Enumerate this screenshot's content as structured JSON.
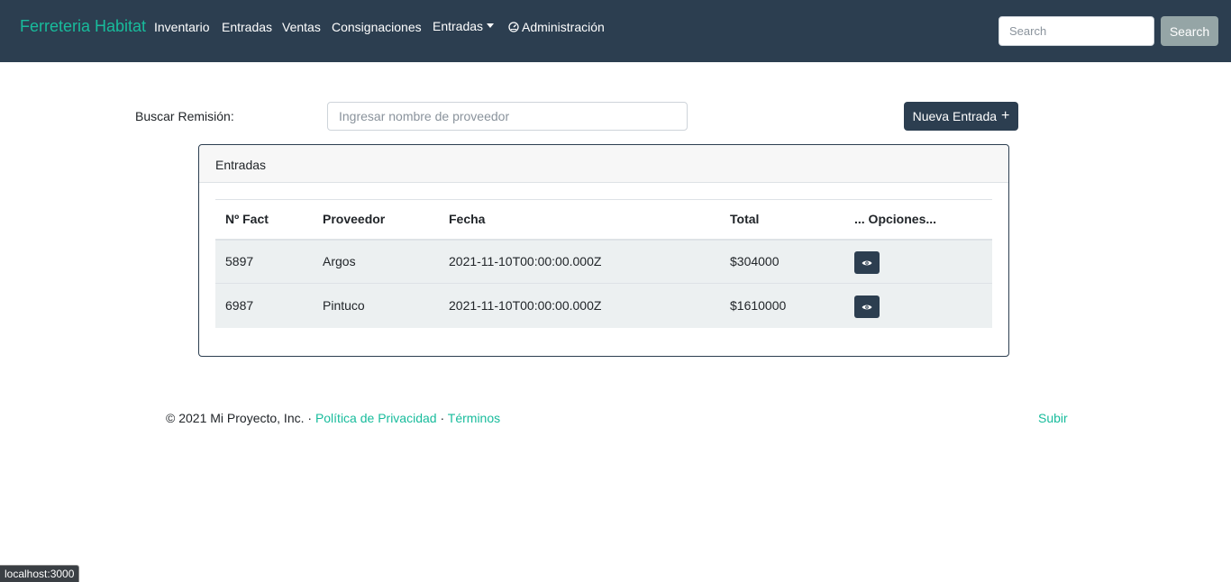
{
  "navbar": {
    "brand": "Ferreteria Habitat",
    "links": [
      "Inventario",
      "Entradas",
      "Ventas",
      "Consignaciones"
    ],
    "dropdown_label": "Entradas",
    "admin_label": "Administración",
    "search_placeholder": "Search",
    "search_button": "Search"
  },
  "filter": {
    "label": "Buscar Remisión:",
    "placeholder": "Ingresar nombre de proveedor",
    "new_button": "Nueva Entrada",
    "new_icon": "+"
  },
  "card": {
    "title": "Entradas",
    "columns": [
      "Nº Fact",
      "Proveedor",
      "Fecha",
      "Total",
      "... Opciones..."
    ],
    "rows": [
      {
        "fact": "5897",
        "proveedor": "Argos",
        "fecha": "2021-11-10T00:00:00.000Z",
        "total": "$304000",
        "action_icon": "eye-icon"
      },
      {
        "fact": "6987",
        "proveedor": "Pintuco",
        "fecha": "2021-11-10T00:00:00.000Z",
        "total": "$1610000",
        "action_icon": "eye-icon"
      }
    ]
  },
  "footer": {
    "copyright": "© 2021 Mi Proyecto, Inc. · ",
    "privacy": "Política de Privacidad",
    "separator": " · ",
    "terms": "Términos",
    "up": "Subir"
  },
  "status_bar": {
    "url": "localhost:3000"
  },
  "colors": {
    "navbar": "#2c3e50",
    "accent": "#18bc9c",
    "search_button": "#95a5a6",
    "row_background": "#ecf0f1"
  }
}
